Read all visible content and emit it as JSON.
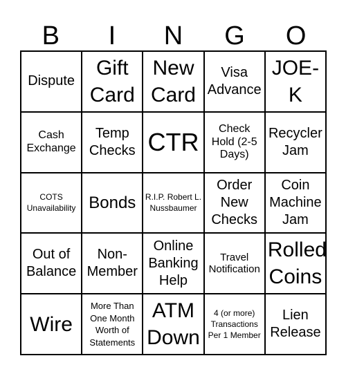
{
  "header": [
    "B",
    "I",
    "N",
    "G",
    "O"
  ],
  "cells": [
    "Dispute",
    "Gift Card",
    "New Card",
    "Visa Advance",
    "JOE-K",
    "Cash Exchange",
    "Temp Checks",
    "CTR",
    "Check Hold (2-5 Days)",
    "Recycler Jam",
    "COTS Unavailability",
    "Bonds",
    "R.I.P. Robert L. Nussbaumer",
    "Order New Checks",
    "Coin Machine Jam",
    "Out of Balance",
    "Non-Member",
    "Online Banking Help",
    "Travel Notification",
    "Rolled Coins",
    "Wire",
    "More Than One Month Worth of Statements",
    "ATM Down",
    "4 (or more) Transactions Per 1 Member",
    "Lien Release"
  ]
}
